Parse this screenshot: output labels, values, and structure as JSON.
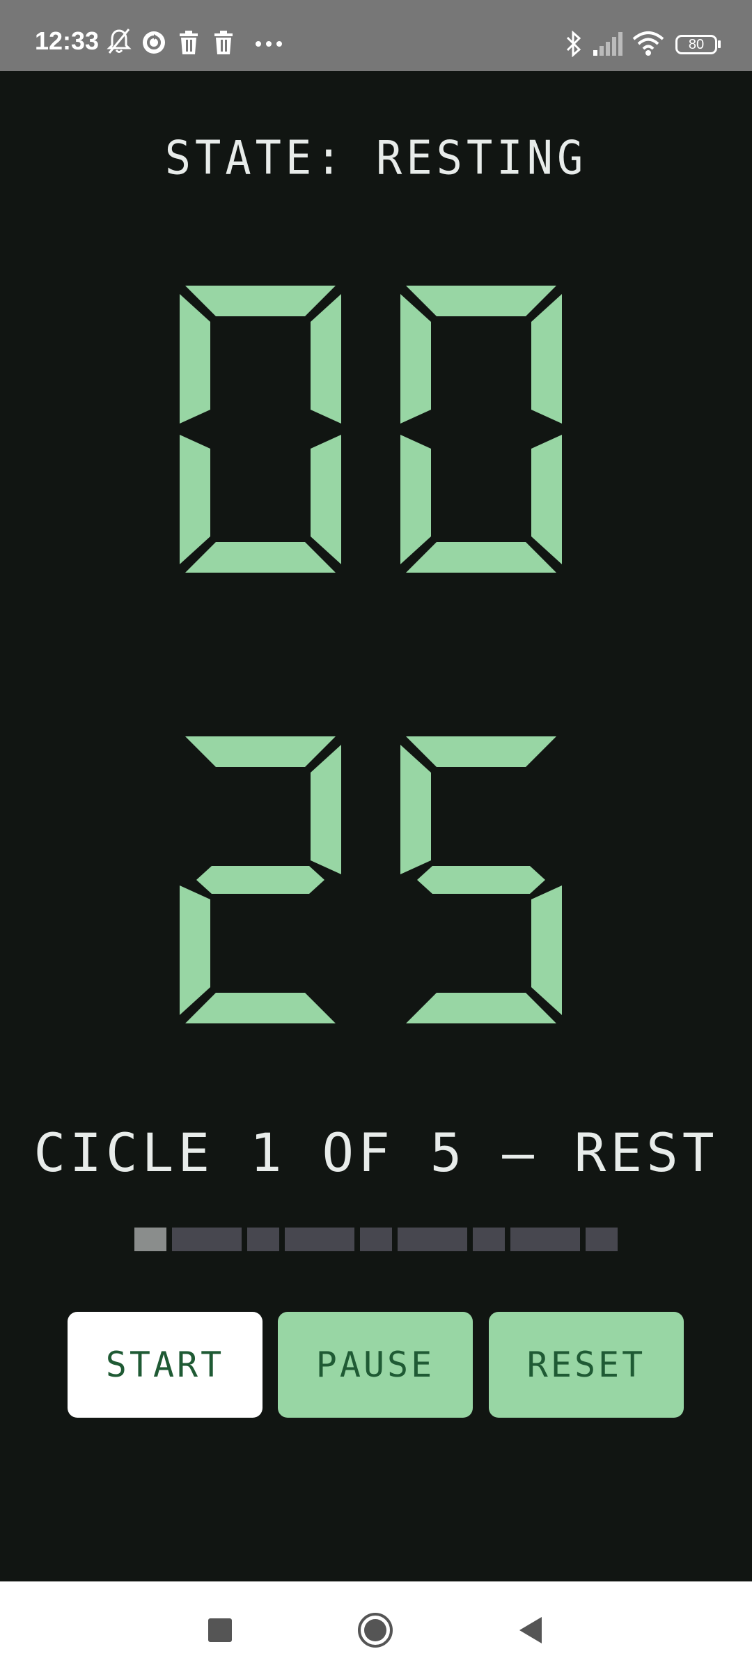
{
  "status_bar": {
    "time": "12:33",
    "battery": "80",
    "icons": [
      "bell-off-icon",
      "sync-icon",
      "trash-icon",
      "trash-icon",
      "more-icon",
      "bluetooth-icon",
      "signal-icon",
      "wifi-icon",
      "battery-icon"
    ]
  },
  "timer": {
    "state_label": "STATE: RESTING",
    "minutes": "00",
    "seconds": "25",
    "cycle_label": "CICLE 1 OF 5 — REST",
    "progress": {
      "total_steps": 9,
      "current_step": 1
    }
  },
  "controls": {
    "start_label": "START",
    "pause_label": "PAUSE",
    "reset_label": "RESET"
  },
  "colors": {
    "background": "#111512",
    "accent": "#98d6a4",
    "text": "#e8ecea",
    "button_text": "#1f5a34"
  },
  "nav_bar": {
    "icons": [
      "recents-square-icon",
      "home-circle-icon",
      "back-triangle-icon"
    ]
  }
}
